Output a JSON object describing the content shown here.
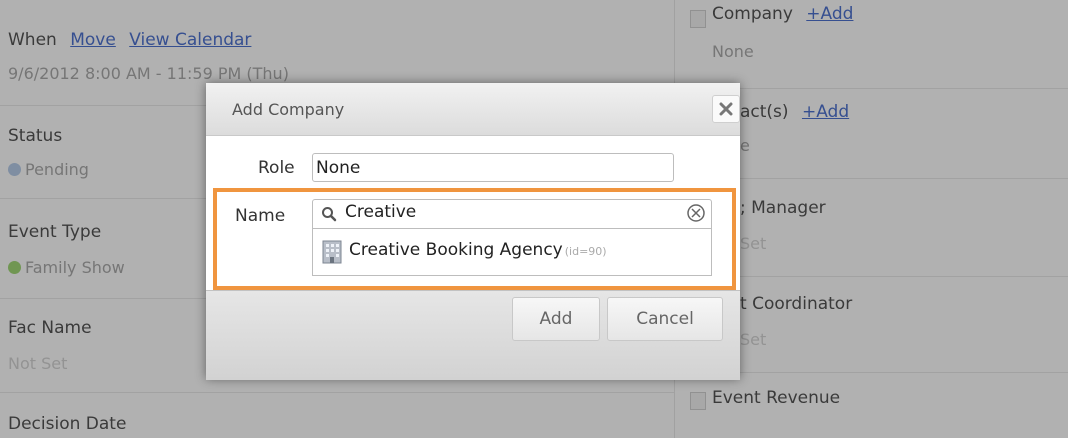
{
  "background": {
    "left": {
      "when_label": "When",
      "move_link": "Move",
      "view_calendar_link": "View Calendar",
      "when_value": "9/6/2012 8:00 AM - 11:59 PM (Thu)",
      "status_label": "Status",
      "status_value": "Pending",
      "event_type_label": "Event Type",
      "event_type_value": "Family Show",
      "fac_name_label": "Fac Name",
      "fac_name_value": "Not Set",
      "decision_date_label": "Decision Date"
    },
    "right": {
      "company_label": "Company",
      "company_add": "+Add",
      "company_value": "None",
      "contacts_label": "act(s)",
      "contacts_add": "+Add",
      "contacts_value": "e",
      "manager_label": "; Manager",
      "manager_value": "Set",
      "coordinator_label": "t Coordinator",
      "coordinator_value": "Set",
      "revenue_label": "Event Revenue"
    }
  },
  "dialog": {
    "title": "Add Company",
    "role_label": "Role",
    "role_value": "None",
    "name_label": "Name",
    "name_value": "Creative",
    "suggestion_name": "Creative Booking Agency",
    "suggestion_id": "(id=90)",
    "add_button": "Add",
    "cancel_button": "Cancel"
  },
  "colors": {
    "link": "#2b57c7",
    "highlight": "#f0953f",
    "status_dot": "#a9c3e6",
    "event_dot": "#8fd05c"
  },
  "icons": {
    "search": "search-icon",
    "clear": "clear-icon",
    "close": "close-icon",
    "building": "building-icon",
    "edit": "edit-icon"
  }
}
